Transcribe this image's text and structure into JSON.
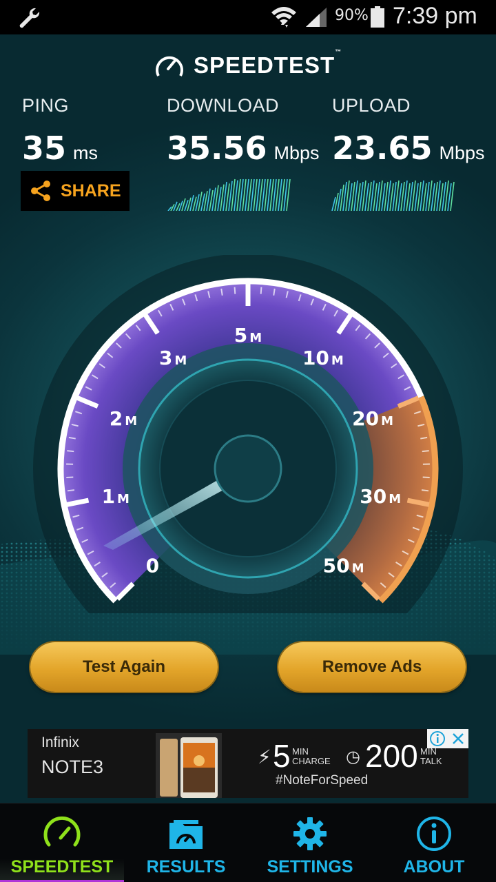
{
  "status_bar": {
    "battery_percent": "90%",
    "time": "7:39 pm"
  },
  "brand": {
    "name": "SPEEDTEST",
    "trademark": "™"
  },
  "results": {
    "ping": {
      "label": "PING",
      "value": "35",
      "unit": "ms"
    },
    "download": {
      "label": "DOWNLOAD",
      "value": "35.56",
      "unit": "Mbps"
    },
    "upload": {
      "label": "UPLOAD",
      "value": "23.65",
      "unit": "Mbps"
    }
  },
  "share": {
    "label": "SHARE"
  },
  "gauge": {
    "ticks": [
      {
        "num": "0",
        "unit": ""
      },
      {
        "num": "1",
        "unit": "M"
      },
      {
        "num": "2",
        "unit": "M"
      },
      {
        "num": "3",
        "unit": "M"
      },
      {
        "num": "5",
        "unit": "M"
      },
      {
        "num": "10",
        "unit": "M"
      },
      {
        "num": "20",
        "unit": "M"
      },
      {
        "num": "30",
        "unit": "M"
      },
      {
        "num": "50",
        "unit": "M"
      }
    ],
    "accent_colors": {
      "ring": "#ffffff",
      "inner_glow": "#7a3ed8",
      "high_range": "#e8872a",
      "needle": "#9ff3ff"
    }
  },
  "buttons": {
    "test_again": "Test Again",
    "remove_ads": "Remove Ads"
  },
  "ad": {
    "brand": "Infinix",
    "model": "NOTE3",
    "charge_value": "5",
    "charge_sub": "MIN CHARGE",
    "talk_value": "200",
    "talk_sub": "MIN TALK",
    "hashtag": "#NoteForSpeed"
  },
  "nav": {
    "items": [
      {
        "label": "SPEEDTEST",
        "icon": "speedometer-icon",
        "active": true
      },
      {
        "label": "RESULTS",
        "icon": "results-folder-icon",
        "active": false
      },
      {
        "label": "SETTINGS",
        "icon": "gear-icon",
        "active": false
      },
      {
        "label": "ABOUT",
        "icon": "info-icon",
        "active": false
      }
    ],
    "active_color": "#8fe11b",
    "inactive_color": "#1fb5e8"
  }
}
